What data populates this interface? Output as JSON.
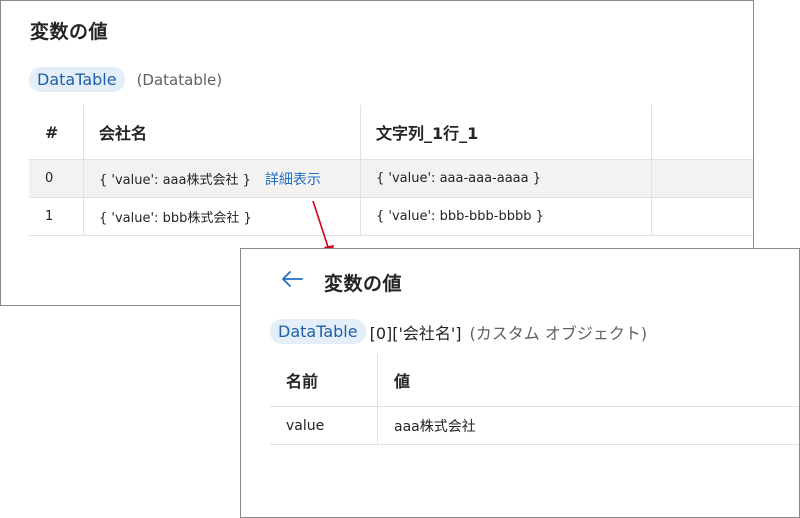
{
  "panel_a": {
    "title": "変数の値",
    "badge": "DataTable",
    "type_text": "(Datatable)",
    "columns": [
      "#",
      "会社名",
      "文字列_1行_1"
    ],
    "rows": [
      {
        "index": "0",
        "company": "{ 'value': aaa株式会社 }",
        "link": "詳細表示",
        "text": "{ 'value': aaa-aaa-aaaa }"
      },
      {
        "index": "1",
        "company": "{ 'value': bbb株式会社 }",
        "text": "{ 'value': bbb-bbb-bbbb }"
      }
    ]
  },
  "panel_b": {
    "title": "変数の値",
    "badge": "DataTable",
    "path": "[0]['会社名']",
    "type_text": "(カスタム オブジェクト)",
    "columns": [
      "名前",
      "値"
    ],
    "rows": [
      {
        "name": "value",
        "value": "aaa株式会社"
      }
    ]
  },
  "colors": {
    "badge_bg": "#e3eef9",
    "badge_text": "#1f5fa8",
    "link": "#1f6ec4",
    "arrow": "#d0021b",
    "highlight_row": "#f3f2f1"
  },
  "icons": [
    "back-arrow-icon"
  ]
}
